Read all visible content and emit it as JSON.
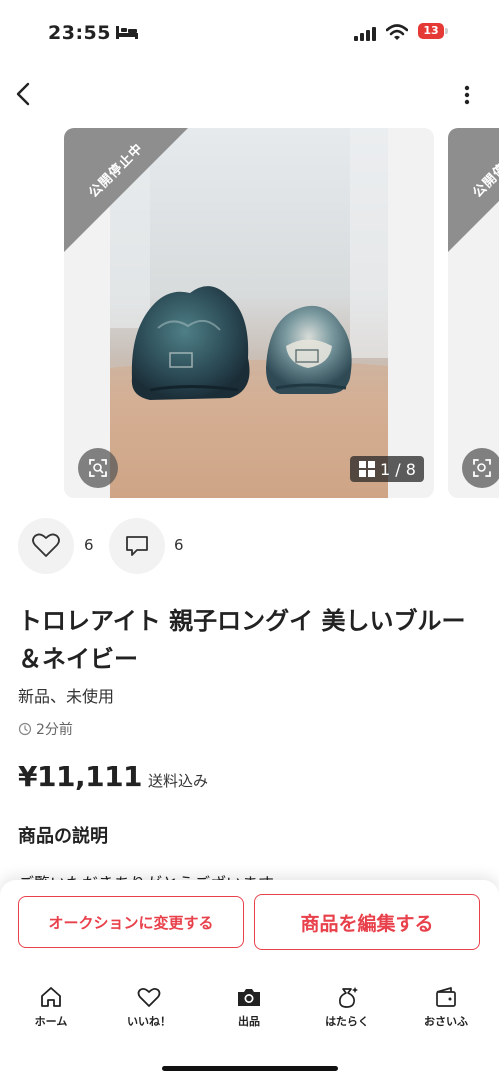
{
  "status_bar": {
    "time": "23:55",
    "battery_level": "13"
  },
  "nav": {
    "back_icon": "chevron-left-icon",
    "more_icon": "more-vertical-icon"
  },
  "gallery": {
    "status_ribbon": "公開停止中",
    "photo_counter": "1 / 8",
    "current_photo": 1,
    "total_photos": 8
  },
  "reactions": {
    "likes": "6",
    "comments": "6"
  },
  "item": {
    "title": "トロレアイト 親子ロングイ 美しいブルー＆ネイビー",
    "condition": "新品、未使用",
    "posted": "2分前",
    "price": "¥11,111",
    "shipping_note": "送料込み"
  },
  "description": {
    "heading": "商品の説明",
    "text_partial": "ご覧いただきありがとうございます"
  },
  "actions": {
    "auction_label": "オークションに変更する",
    "edit_label": "商品を編集する"
  },
  "tabs": [
    {
      "label": "ホーム",
      "icon": "home-icon"
    },
    {
      "label": "いいね！",
      "icon": "heart-icon"
    },
    {
      "label": "出品",
      "icon": "camera-icon"
    },
    {
      "label": "はたらく",
      "icon": "money-bag-icon"
    },
    {
      "label": "おさいふ",
      "icon": "wallet-icon"
    }
  ],
  "colors": {
    "accent": "#e8414b",
    "ribbon": "#8e8e8e",
    "battery_low": "#e53935"
  }
}
